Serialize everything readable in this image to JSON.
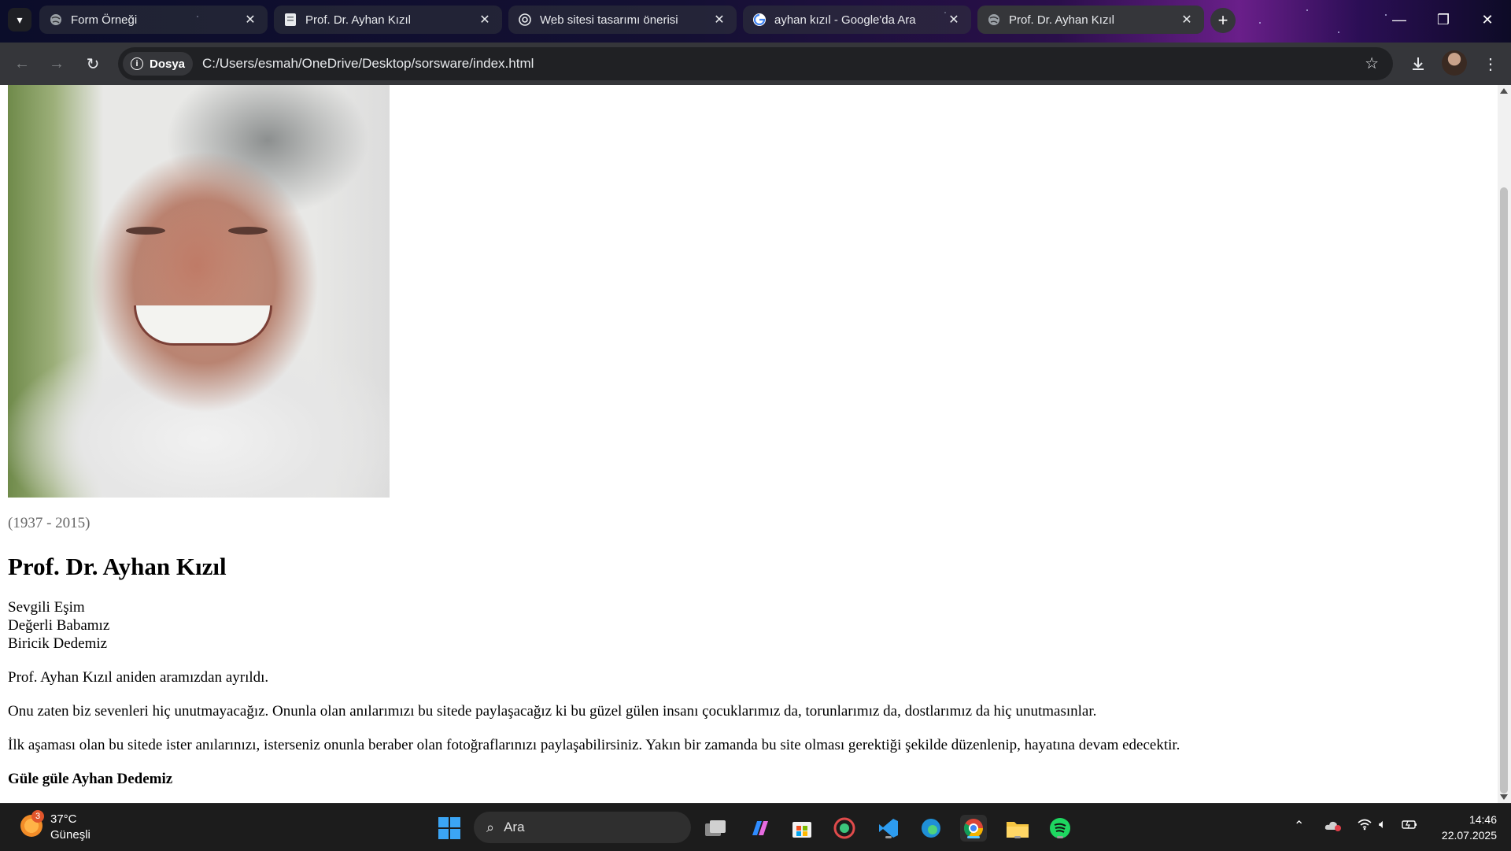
{
  "browser": {
    "tabs": [
      {
        "title": "Form Örneği",
        "icon": "globe-icon",
        "active": false
      },
      {
        "title": "Prof. Dr. Ayhan Kızıl",
        "icon": "document-icon",
        "active": false
      },
      {
        "title": "Web sitesi tasarımı önerisi",
        "icon": "chatgpt-icon",
        "active": false
      },
      {
        "title": "ayhan kızıl - Google'da Ara",
        "icon": "google-icon",
        "active": false
      },
      {
        "title": "Prof. Dr. Ayhan Kızıl",
        "icon": "globe-icon",
        "active": true
      }
    ],
    "address": {
      "chip_label": "Dosya",
      "url": "C:/Users/esmah/OneDrive/Desktop/sorsware/index.html"
    }
  },
  "page": {
    "photo_alt": "portrait-photo",
    "years": "(1937 - 2015)",
    "heading": "Prof. Dr. Ayhan Kızıl",
    "lines": [
      "Sevgili Eşim",
      "Değerli Babamız",
      "Biricik Dedemiz"
    ],
    "para1": "Prof. Ayhan Kızıl aniden aramızdan ayrıldı.",
    "para2": "Onu zaten biz sevenleri hiç unutmayacağız. Onunla olan anılarımızı bu sitede paylaşacağız ki bu güzel gülen insanı çocuklarımız da, torunlarımız da, dostlarımız da hiç unutmasınlar.",
    "para3": "İlk aşaması olan bu sitede ister anılarınızı, isterseniz onunla beraber olan fotoğraflarınızı paylaşabilirsiniz. Yakın bir zamanda bu site olması gerektiği şekilde düzenlenip, hayatına devam edecektir.",
    "closing": "Güle güle Ayhan Dedemiz"
  },
  "taskbar": {
    "weather": {
      "temp": "37°C",
      "condition": "Güneşli",
      "badge": "3"
    },
    "search_placeholder": "Ara",
    "time": "14:46",
    "date": "22.07.2025"
  }
}
